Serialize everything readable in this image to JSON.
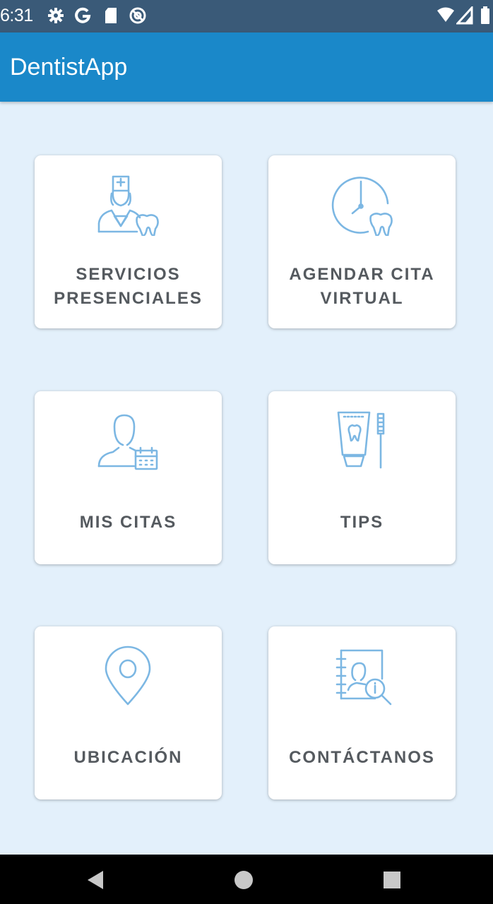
{
  "status_bar": {
    "time": "6:31",
    "icons_left": [
      "gear-icon",
      "google-icon",
      "sd-card-icon",
      "sync-icon"
    ],
    "icons_right": [
      "wifi-icon",
      "signal-icon",
      "battery-icon"
    ]
  },
  "app_bar": {
    "title": "DentistApp"
  },
  "menu": {
    "accent_color": "#7cb7e3",
    "items": [
      {
        "label": "SERVICIOS\nPRESENCIALES",
        "icon": "nurse-tooth-icon"
      },
      {
        "label": "AGENDAR CITA\nVIRTUAL",
        "icon": "clock-tooth-icon"
      },
      {
        "label": "MIS CITAS",
        "icon": "user-calendar-icon"
      },
      {
        "label": "TIPS",
        "icon": "toothpaste-brush-icon"
      },
      {
        "label": "UBICACIÓN",
        "icon": "location-pin-icon"
      },
      {
        "label": "CONTÁCTANOS",
        "icon": "contact-book-search-icon"
      }
    ]
  },
  "nav_bar": {
    "buttons": [
      "back-icon",
      "home-icon",
      "recents-icon"
    ]
  },
  "colors": {
    "app_bar": "#1a88c9",
    "status_bar": "#3a5a78",
    "background": "#e3f0fb",
    "label": "#555a5f"
  }
}
